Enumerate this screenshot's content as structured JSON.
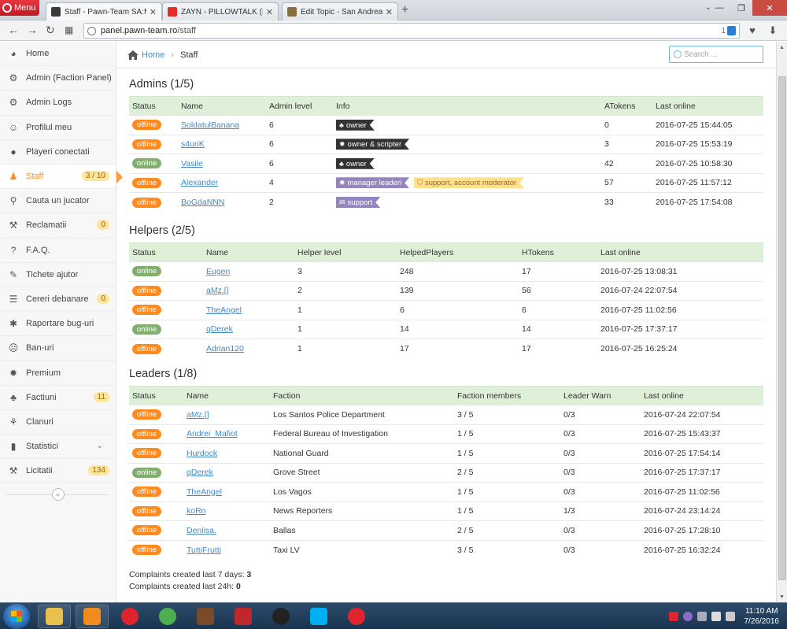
{
  "browser": {
    "menu_label": "Menu",
    "tabs": [
      {
        "title": "Staff - Pawn-Team SA:MP",
        "color": "#3a3a3a",
        "active": true
      },
      {
        "title": "ZAYN - PILLOWTALK (Beat",
        "color": "#e52d27",
        "active": false
      },
      {
        "title": "Edit Topic - San Andreas M",
        "color": "#8a6d3b",
        "active": false
      }
    ],
    "url_host": "panel.pawn-team.ro",
    "url_path": "/staff",
    "notif_count": "1"
  },
  "sidebar": {
    "items": [
      {
        "label": "Home",
        "icon": "dashboard-icon",
        "glyph": "◕",
        "badge": ""
      },
      {
        "label": "Admin (Faction Panel)",
        "icon": "sitemap-icon",
        "glyph": "⚙",
        "badge": ""
      },
      {
        "label": "Admin Logs",
        "icon": "sitemap-icon",
        "glyph": "⚙",
        "badge": ""
      },
      {
        "label": "Profilul meu",
        "icon": "smile-icon",
        "glyph": "☺",
        "badge": ""
      },
      {
        "label": "Playeri conectati",
        "icon": "user-icon",
        "glyph": "●",
        "badge": ""
      },
      {
        "label": "Staff",
        "icon": "android-icon",
        "glyph": "♟",
        "badge": "3 / 10",
        "active": true
      },
      {
        "label": "Cauta un jucator",
        "icon": "search-icon",
        "glyph": "⚲",
        "badge": ""
      },
      {
        "label": "Reclamatii",
        "icon": "gavel-icon",
        "glyph": "⚒",
        "badge": "0"
      },
      {
        "label": "F.A.Q.",
        "icon": "question-icon",
        "glyph": "?",
        "badge": ""
      },
      {
        "label": "Tichete ajutor",
        "icon": "ticket-icon",
        "glyph": "✎",
        "badge": ""
      },
      {
        "label": "Cereri debanare",
        "icon": "list-icon",
        "glyph": "☰",
        "badge": "0"
      },
      {
        "label": "Raportare bug-uri",
        "icon": "bug-icon",
        "glyph": "✱",
        "badge": ""
      },
      {
        "label": "Ban-uri",
        "icon": "frown-icon",
        "glyph": "☹",
        "badge": ""
      },
      {
        "label": "Premium",
        "icon": "gear-icon",
        "glyph": "✹",
        "badge": ""
      },
      {
        "label": "Factiuni",
        "icon": "users-icon",
        "glyph": "♣",
        "badge": "11"
      },
      {
        "label": "Clanuri",
        "icon": "sitemap-icon",
        "glyph": "⚘",
        "badge": ""
      },
      {
        "label": "Statistici",
        "icon": "signal-icon",
        "glyph": "▮",
        "badge": "",
        "caret": "⌄"
      },
      {
        "label": "Licitatii",
        "icon": "gavel-icon",
        "glyph": "⚒",
        "badge": "134"
      }
    ]
  },
  "breadcrumb": {
    "home": "Home",
    "current": "Staff"
  },
  "search": {
    "placeholder": "Search ..."
  },
  "admins": {
    "title": "Admins (1/5)",
    "headers": [
      "Status",
      "Name",
      "Admin level",
      "Info",
      "ATokens",
      "Last online"
    ],
    "rows": [
      {
        "status": "offline",
        "name": "SoldatulBanana",
        "level": "6",
        "tags": [
          {
            "text": "owner",
            "style": "dark",
            "glyph": "♣"
          }
        ],
        "tokens": "0",
        "last": "2016-07-25 15:44:05"
      },
      {
        "status": "offline",
        "name": "s4uriK",
        "level": "6",
        "tags": [
          {
            "text": "owner & scripter",
            "style": "dark",
            "glyph": "✹"
          }
        ],
        "tokens": "3",
        "last": "2016-07-25 15:53:19"
      },
      {
        "status": "online",
        "name": "Vasile",
        "level": "6",
        "tags": [
          {
            "text": "owner",
            "style": "dark",
            "glyph": "♣"
          }
        ],
        "tokens": "42",
        "last": "2016-07-25 10:58:30"
      },
      {
        "status": "offline",
        "name": "Alexander",
        "level": "4",
        "tags": [
          {
            "text": "manager leaderi",
            "style": "purple",
            "glyph": "✹"
          },
          {
            "text": "support, account moderator",
            "style": "yellow",
            "glyph": "⛉"
          }
        ],
        "tokens": "57",
        "last": "2016-07-25 11:57:12"
      },
      {
        "status": "offline",
        "name": "BoGdaNNN",
        "level": "2",
        "tags": [
          {
            "text": "support",
            "style": "purple",
            "glyph": "✉"
          }
        ],
        "tokens": "33",
        "last": "2016-07-25 17:54:08"
      }
    ]
  },
  "helpers": {
    "title": "Helpers (2/5)",
    "headers": [
      "Status",
      "Name",
      "Helper level",
      "HelpedPlayers",
      "HTokens",
      "Last online"
    ],
    "rows": [
      {
        "status": "online",
        "name": "Eugen",
        "level": "3",
        "helped": "248",
        "tokens": "17",
        "last": "2016-07-25 13:08:31"
      },
      {
        "status": "offline",
        "name": "aMz.[]",
        "level": "2",
        "helped": "139",
        "tokens": "56",
        "last": "2016-07-24 22:07:54"
      },
      {
        "status": "offline",
        "name": "TheAngel",
        "level": "1",
        "helped": "6",
        "tokens": "6",
        "last": "2016-07-25 11:02:56"
      },
      {
        "status": "online",
        "name": "qDerek",
        "level": "1",
        "helped": "14",
        "tokens": "14",
        "last": "2016-07-25 17:37:17"
      },
      {
        "status": "offline",
        "name": "Adrian120",
        "level": "1",
        "helped": "17",
        "tokens": "17",
        "last": "2016-07-25 16:25:24"
      }
    ]
  },
  "leaders": {
    "title": "Leaders (1/8)",
    "headers": [
      "Status",
      "Name",
      "Faction",
      "Faction members",
      "Leader Warn",
      "Last online"
    ],
    "rows": [
      {
        "status": "offline",
        "name": "aMz.[]",
        "faction": "Los Santos Police Department",
        "members": "3 / 5",
        "warn": "0/3",
        "last": "2016-07-24 22:07:54"
      },
      {
        "status": "offline",
        "name": "Andrei_Mafiot",
        "faction": "Federal Bureau of Investigation",
        "members": "1 / 5",
        "warn": "0/3",
        "last": "2016-07-25 15:43:37"
      },
      {
        "status": "offline",
        "name": "Hurdock",
        "faction": "National Guard",
        "members": "1 / 5",
        "warn": "0/3",
        "last": "2016-07-25 17:54:14"
      },
      {
        "status": "online",
        "name": "qDerek",
        "faction": "Grove Street",
        "members": "2 / 5",
        "warn": "0/3",
        "last": "2016-07-25 17:37:17"
      },
      {
        "status": "offline",
        "name": "TheAngel",
        "faction": "Los Vagos",
        "members": "1 / 5",
        "warn": "0/3",
        "last": "2016-07-25 11:02:56"
      },
      {
        "status": "offline",
        "name": "koRn",
        "faction": "News Reporters",
        "members": "1 / 5",
        "warn": "1/3",
        "last": "2016-07-24 23:14:24"
      },
      {
        "status": "offline",
        "name": "Deniisa.",
        "faction": "Ballas",
        "members": "2 / 5",
        "warn": "0/3",
        "last": "2016-07-25 17:28:10"
      },
      {
        "status": "offline",
        "name": "TuttiFrutti",
        "faction": "Taxi LV",
        "members": "3 / 5",
        "warn": "0/3",
        "last": "2016-07-25 16:32:24"
      }
    ]
  },
  "stats": {
    "week_label": "Complaints created last 7 days:",
    "week_value": "3",
    "day_label": "Complaints created last 24h:",
    "day_value": "0"
  },
  "taskbar": {
    "apps": [
      {
        "name": "explorer-app",
        "color": "#e8c14d"
      },
      {
        "name": "media-player-app",
        "color": "#f28b1e"
      },
      {
        "name": "opera-app",
        "color": "#e0242f"
      },
      {
        "name": "chrome-app",
        "color": "#4caf50"
      },
      {
        "name": "game-app",
        "color": "#7b4a2a"
      },
      {
        "name": "filezilla-app",
        "color": "#c0272d"
      },
      {
        "name": "obs-app",
        "color": "#222222"
      },
      {
        "name": "skype-app",
        "color": "#00aff0"
      },
      {
        "name": "opera-app-2",
        "color": "#e0242f"
      }
    ],
    "time": "11:10 AM",
    "date": "7/26/2016"
  },
  "colors": {
    "offline": "#ff8b1f",
    "online": "#82af6f",
    "header_bg": "#dff0d8",
    "link": "#428bca"
  }
}
